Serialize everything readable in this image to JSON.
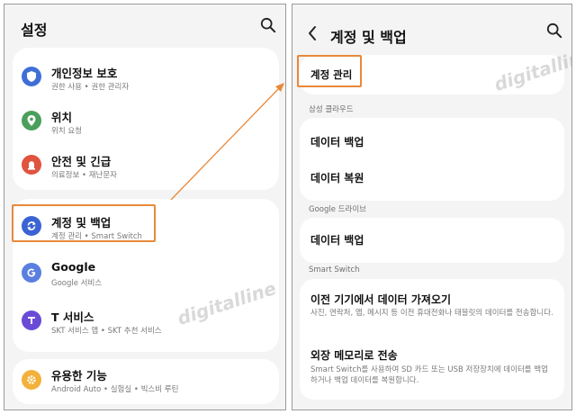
{
  "left": {
    "title": "설정",
    "items": [
      {
        "title": "개인정보 보호",
        "subtitle": "권한 사용 • 권한 관리자"
      },
      {
        "title": "위치",
        "subtitle": "위치 요청"
      },
      {
        "title": "안전 및 긴급",
        "subtitle": "의료정보 • 재난문자"
      },
      {
        "title": "계정 및 백업",
        "subtitle": "계정 관리 • Smart Switch"
      },
      {
        "title": "Google",
        "subtitle": "Google 서비스"
      },
      {
        "title": "T 서비스",
        "subtitle": "SKT 서비스 앱 • SKT 추천 서비스"
      },
      {
        "title": "유용한 기능",
        "subtitle": "Android Auto • 실험실 • 빅스비 루틴"
      }
    ]
  },
  "right": {
    "title": "계정 및 백업",
    "account_manage": "계정 관리",
    "section_samsung": "삼성 클라우드",
    "samsung_backup": "데이터 백업",
    "samsung_restore": "데이터 복원",
    "section_google": "Google 드라이브",
    "google_backup": "데이터 백업",
    "section_switch": "Smart Switch",
    "transfer_title": "이전 기기에서 데이터 가져오기",
    "transfer_sub": "사진, 연락처, 앱, 메시지 등 이전 휴대전화나 태블릿의 데이터를 전송합니다.",
    "external_title": "외장 메모리로 전송",
    "external_sub": "Smart Switch를 사용하여 SD 카드 또는 USB 저장장치에 데이터를 백업하거나 백업 데이터를 복원합니다."
  },
  "watermark": "digitalline",
  "colors": {
    "highlight": "#e8893a",
    "privacy_icon": "#3f6fd6",
    "location_icon": "#4aa05a",
    "safety_icon": "#e0533f",
    "account_icon": "#3b63d4",
    "google_icon": "#5b7fe0",
    "tservice_icon": "#6a4bd6",
    "useful_icon": "#f3b13c"
  }
}
